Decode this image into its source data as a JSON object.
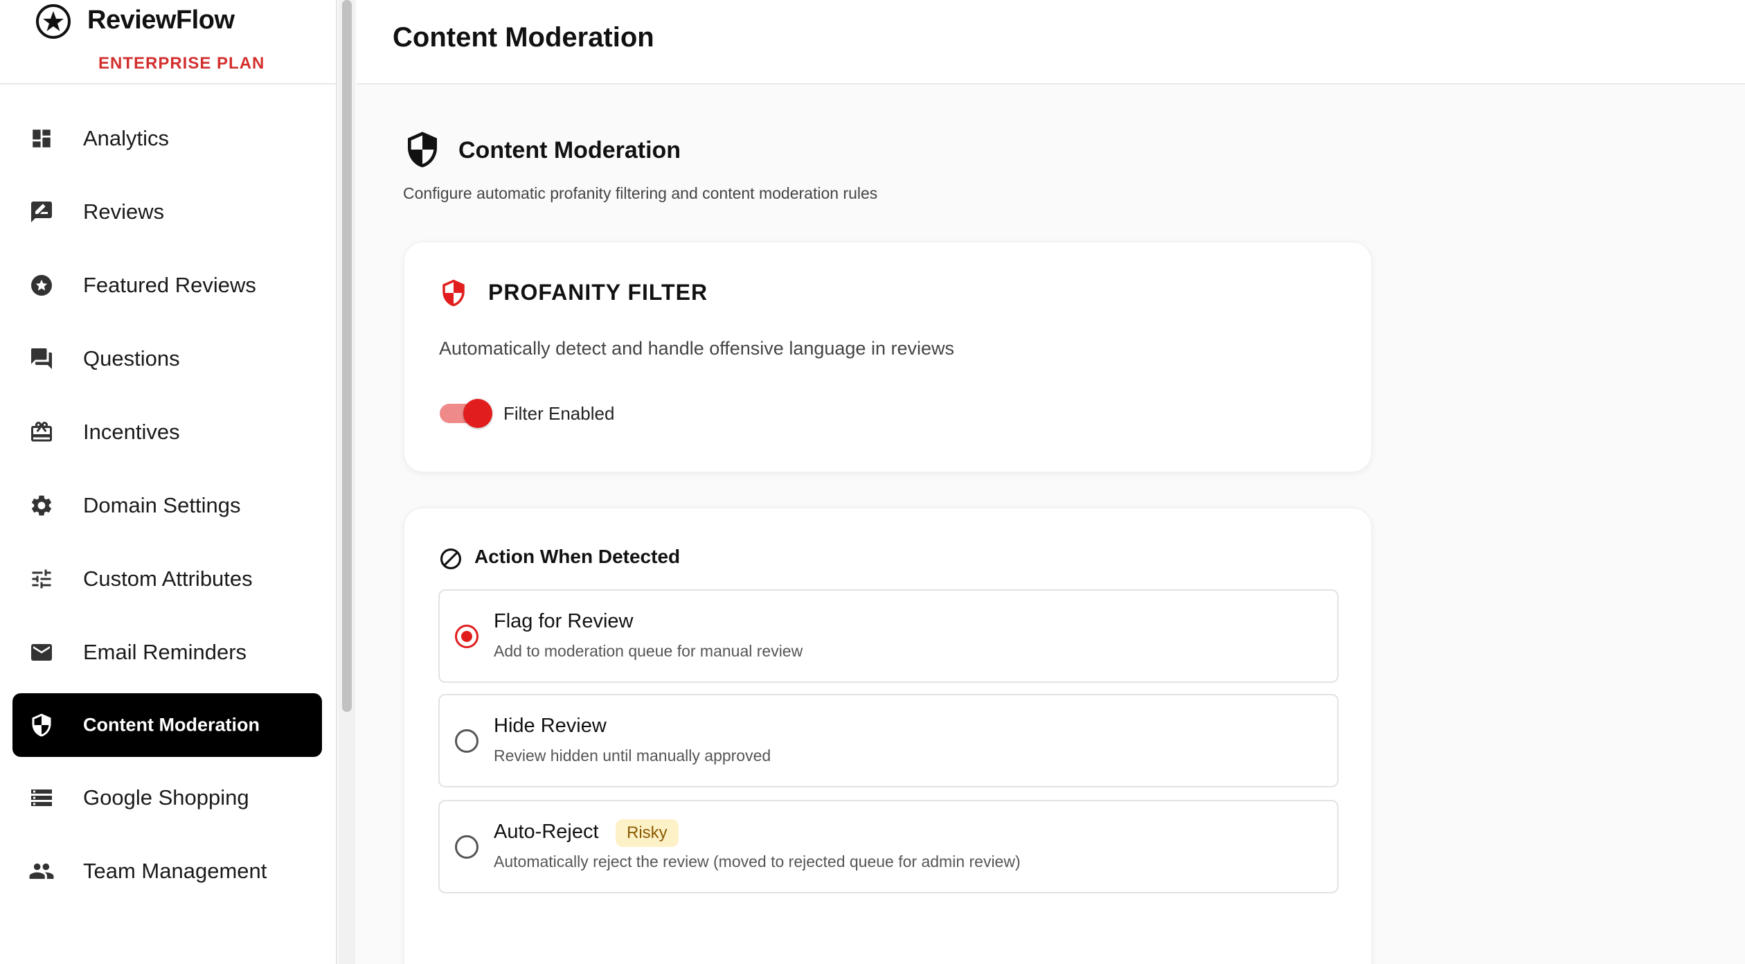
{
  "brand": {
    "name": "ReviewFlow",
    "plan": "ENTERPRISE PLAN"
  },
  "sidebar": {
    "items": [
      {
        "label": "Analytics",
        "icon": "dashboard-icon"
      },
      {
        "label": "Reviews",
        "icon": "rate-review-icon"
      },
      {
        "label": "Featured Reviews",
        "icon": "star-circle-icon"
      },
      {
        "label": "Questions",
        "icon": "forum-icon"
      },
      {
        "label": "Incentives",
        "icon": "gift-card-icon"
      },
      {
        "label": "Domain Settings",
        "icon": "gear-icon"
      },
      {
        "label": "Custom Attributes",
        "icon": "tune-icon"
      },
      {
        "label": "Email Reminders",
        "icon": "mail-icon"
      },
      {
        "label": "Content Moderation",
        "icon": "shield-icon",
        "active": true
      },
      {
        "label": "Google Shopping",
        "icon": "storage-icon"
      },
      {
        "label": "Team Management",
        "icon": "people-icon"
      }
    ]
  },
  "header": {
    "title": "Content Moderation"
  },
  "section": {
    "title": "Content Moderation",
    "description": "Configure automatic profanity filtering and content moderation rules"
  },
  "profanity_filter": {
    "title": "PROFANITY FILTER",
    "description": "Automatically detect and handle offensive language in reviews",
    "toggle_label": "Filter Enabled",
    "enabled": true
  },
  "action": {
    "title": "Action When Detected",
    "options": [
      {
        "title": "Flag for Review",
        "description": "Add to moderation queue for manual review",
        "selected": true
      },
      {
        "title": "Hide Review",
        "description": "Review hidden until manually approved",
        "selected": false
      },
      {
        "title": "Auto-Reject",
        "badge": "Risky",
        "description": "Automatically reject the review (moved to rejected queue for admin review)",
        "selected": false
      }
    ]
  },
  "colors": {
    "accent": "#e11d1d",
    "brand_plan": "#d32f2f",
    "active_nav_bg": "#000000",
    "risky_badge_bg": "#fdf1c7",
    "risky_badge_text": "#8a5a00"
  }
}
